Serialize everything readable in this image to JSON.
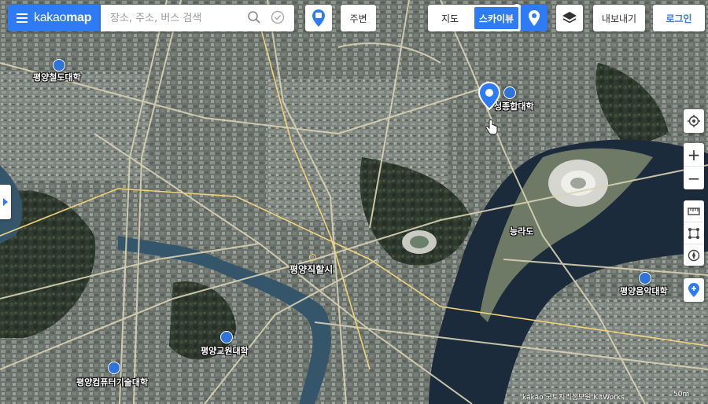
{
  "header": {
    "logo_light": "kakao",
    "logo_bold": "map",
    "search_placeholder": "장소, 주소, 버스 검색",
    "nearby_label": "주변",
    "view_tabs": {
      "map_label": "지도",
      "skyview_label": "스카이뷰",
      "selected": "스카이뷰"
    },
    "export_label": "내보내기",
    "login_label": "로그인",
    "accent_color": "#2f7bf5"
  },
  "map": {
    "labels": {
      "pyongyang_railway_univ": "평양철도대학",
      "sungjong_univ": "성종합대학",
      "city_center": "평양직할시",
      "neungna": "능라도",
      "music_univ": "평양음악대학",
      "education_univ": "평양교원대학",
      "computer_univ": "평양컴퓨터기술대학"
    },
    "copyright": "kakao  국토지리정보원  KitWorks",
    "scale_label": "50m"
  },
  "controls": {
    "icons": [
      "hamburger-icon",
      "search-icon",
      "check-circle-icon",
      "bus-stop-pin-icon",
      "pin-location-icon",
      "layers-icon",
      "gps-target-icon",
      "zoom-in-icon",
      "zoom-out-icon",
      "ruler-icon",
      "area-measure-icon",
      "compass-icon",
      "add-place-icon",
      "expand-panel-icon"
    ],
    "zoom_in": "+",
    "zoom_out": "−"
  }
}
